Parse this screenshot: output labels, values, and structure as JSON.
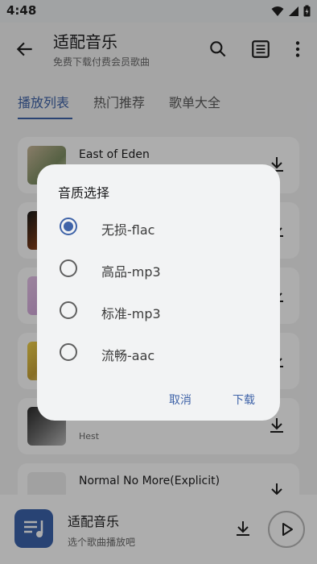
{
  "status": {
    "time": "4:48"
  },
  "header": {
    "title": "适配音乐",
    "subtitle": "免费下载付费会员歌曲"
  },
  "tabs": [
    {
      "label": "播放列表",
      "active": true
    },
    {
      "label": "热门推荐",
      "active": false
    },
    {
      "label": "歌单大全",
      "active": false
    }
  ],
  "songs": [
    {
      "title": "East of Eden",
      "artist": ""
    },
    {
      "title": "",
      "artist": ""
    },
    {
      "title": "",
      "artist": ""
    },
    {
      "title": "",
      "artist": ""
    },
    {
      "title": "",
      "artist": "Hest"
    },
    {
      "title": "Normal No More(Explicit)",
      "artist": ""
    }
  ],
  "player": {
    "title": "适配音乐",
    "subtitle": "选个歌曲播放吧"
  },
  "dialog": {
    "title": "音质选择",
    "options": [
      {
        "label": "无损-flac",
        "selected": true
      },
      {
        "label": "高品-mp3",
        "selected": false
      },
      {
        "label": "标准-mp3",
        "selected": false
      },
      {
        "label": "流畅-aac",
        "selected": false
      }
    ],
    "cancel_label": "取消",
    "confirm_label": "下载"
  },
  "colors": {
    "accent": "#3f63a8",
    "cover": "#3c63ac"
  }
}
